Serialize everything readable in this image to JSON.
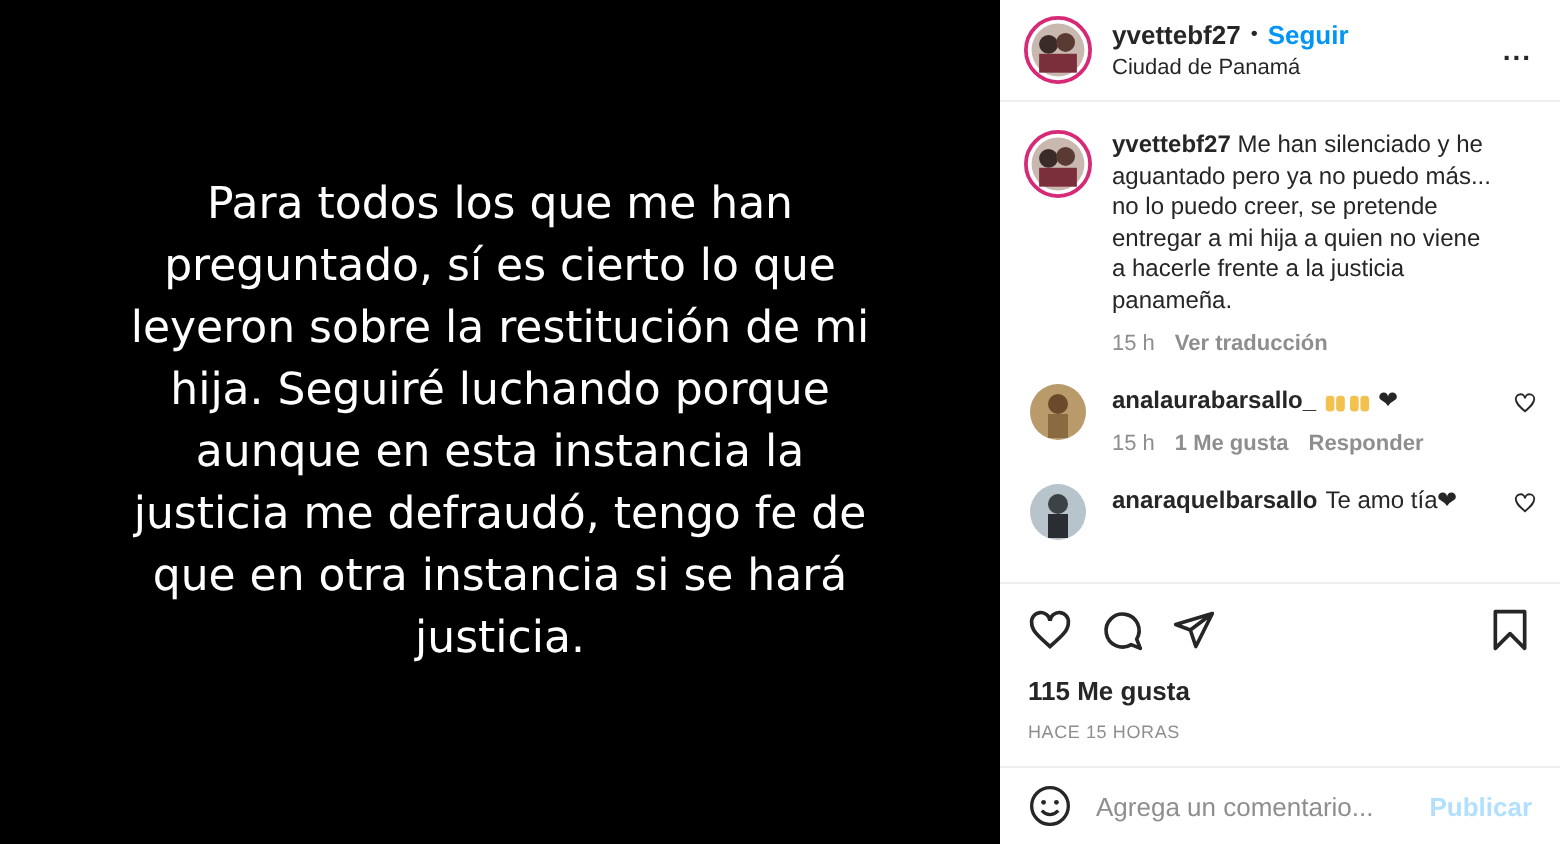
{
  "story": {
    "text": "Para todos los que me han preguntado, sí es cierto lo que leyeron sobre la restitución de mi hija. Seguiré luchando porque aunque en esta instancia la justicia me defraudó, tengo fe de que en otra instancia si se hará justicia."
  },
  "header": {
    "username": "yvettebf27",
    "separator": "•",
    "follow": "Seguir",
    "location": "Ciudad de Panamá",
    "more": "..."
  },
  "caption": {
    "username": "yvettebf27",
    "text": "Me han silenciado y he aguantado pero ya no puedo más... no lo puedo creer, se pretende entregar a mi hija a quien no viene a hacerle frente a la justicia panameña.",
    "time": "15 h",
    "translate": "Ver traducción"
  },
  "comments": [
    {
      "username": "analaurabarsallo_",
      "text": "❤",
      "hands": true,
      "time": "15 h",
      "likes": "1 Me gusta",
      "reply": "Responder"
    },
    {
      "username": "anaraquelbarsallo",
      "text": "Te amo tía❤",
      "hands": false
    }
  ],
  "likes": "115 Me gusta",
  "posted": "HACE 15 HORAS",
  "composer": {
    "placeholder": "Agrega un comentario...",
    "submit": "Publicar"
  }
}
